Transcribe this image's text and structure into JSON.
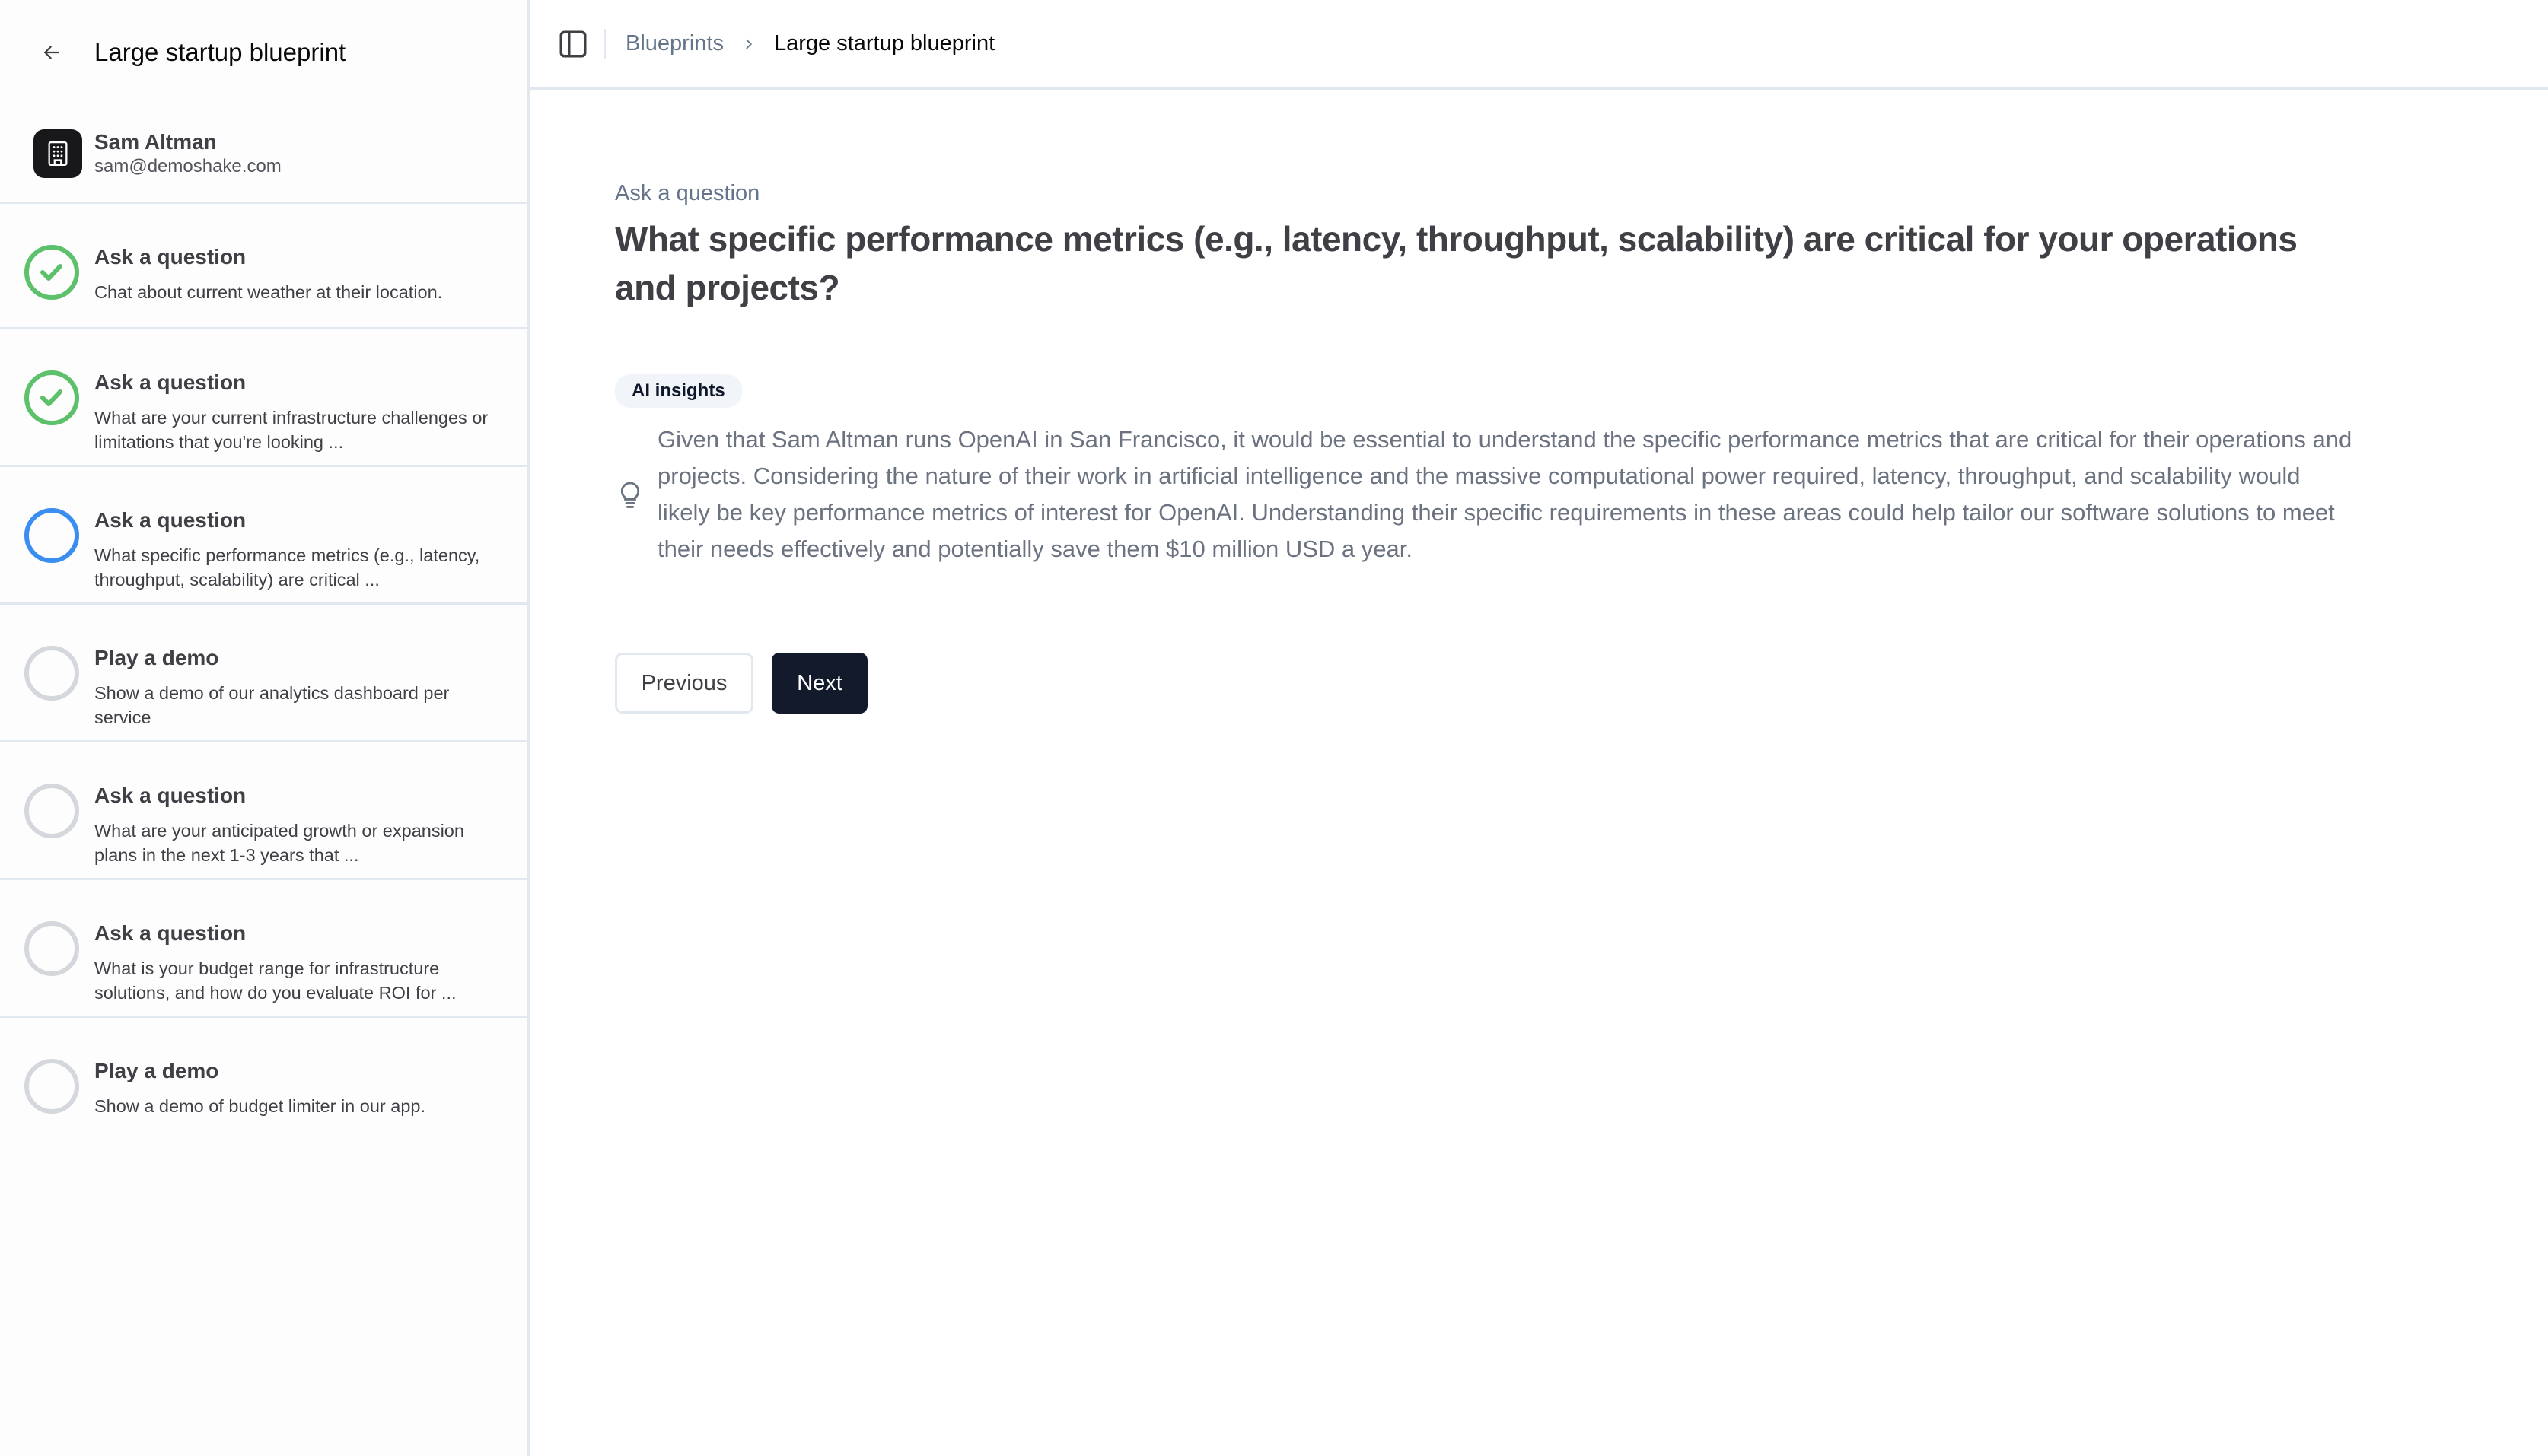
{
  "sidebar": {
    "title": "Large startup blueprint",
    "back_icon": "arrow-left-icon",
    "account": {
      "name": "Sam Altman",
      "email": "sam@demoshake.com",
      "avatar_icon": "building-icon"
    },
    "steps": [
      {
        "title": "Ask a question",
        "desc": "Chat about current weather at their location.",
        "status": "completed"
      },
      {
        "title": "Ask a question",
        "desc": "What are your current infrastructure challenges or limitations that you're looking ...",
        "status": "completed"
      },
      {
        "title": "Ask a question",
        "desc": "What specific performance metrics (e.g., latency, throughput, scalability) are critical ...",
        "status": "current"
      },
      {
        "title": "Play a demo",
        "desc": "Show a demo of our analytics dashboard per service",
        "status": "pending"
      },
      {
        "title": "Ask a question",
        "desc": "What are your anticipated growth or expansion plans in the next 1-3 years that ...",
        "status": "pending"
      },
      {
        "title": "Ask a question",
        "desc": "What is your budget range for infrastructure solutions, and how do you evaluate ROI for ...",
        "status": "pending"
      },
      {
        "title": "Play a demo",
        "desc": "Show a demo of budget limiter in our app.",
        "status": "pending"
      }
    ]
  },
  "topbar": {
    "toggle_icon": "sidebar-toggle-icon",
    "breadcrumb": [
      "Blueprints",
      "Large startup blueprint"
    ]
  },
  "main": {
    "kicker": "Ask a question",
    "heading": "What specific performance metrics (e.g., latency, throughput, scalability) are critical for your operations and projects?",
    "badge": "AI insights",
    "insight_icon": "lightbulb-icon",
    "insight": "Given that Sam Altman runs OpenAI in San Francisco, it would be essential to understand the specific performance metrics that are critical for their operations and projects. Considering the nature of their work in artificial intelligence and the massive computational power required, latency, throughput, and scalability would likely be key performance metrics of interest for OpenAI. Understanding their specific requirements in these areas could help tailor our software solutions to meet their needs effectively and potentially save them $10 million USD a year.",
    "buttons": {
      "previous": "Previous",
      "next": "Next"
    }
  },
  "colors": {
    "completed": "#5cc16a",
    "current": "#3b8ef0",
    "pending": "#d4d7dc",
    "primary_button": "#131a2b",
    "border": "#e2e8f0"
  }
}
